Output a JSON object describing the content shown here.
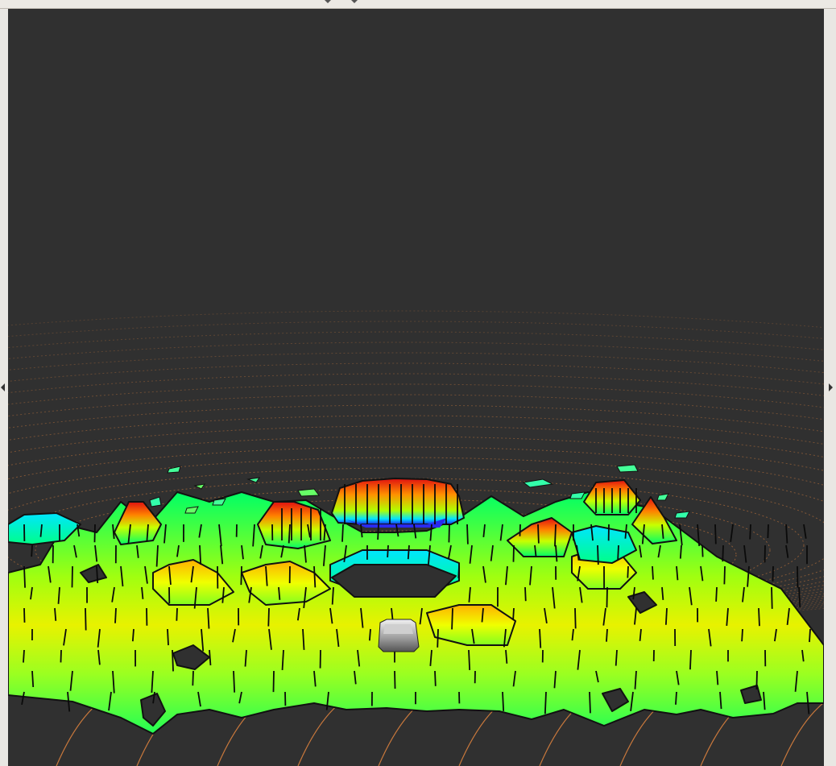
{
  "window": {
    "panel": "3d-render-view"
  },
  "scene": {
    "background_color": "#303030",
    "ring_color": "#c8783c",
    "colormap": [
      "#1a2bff",
      "#00e5ff",
      "#00ff66",
      "#b8ff00",
      "#ffe800",
      "#ff8000",
      "#e01010"
    ],
    "objects": [
      "elevation-heightmap",
      "vehicle-model",
      "lidar-point-rings"
    ]
  },
  "icons": {
    "splitter_left": "triangle-left-icon",
    "splitter_right": "triangle-right-icon",
    "toolbar_handle": "chevron-down-icon"
  }
}
